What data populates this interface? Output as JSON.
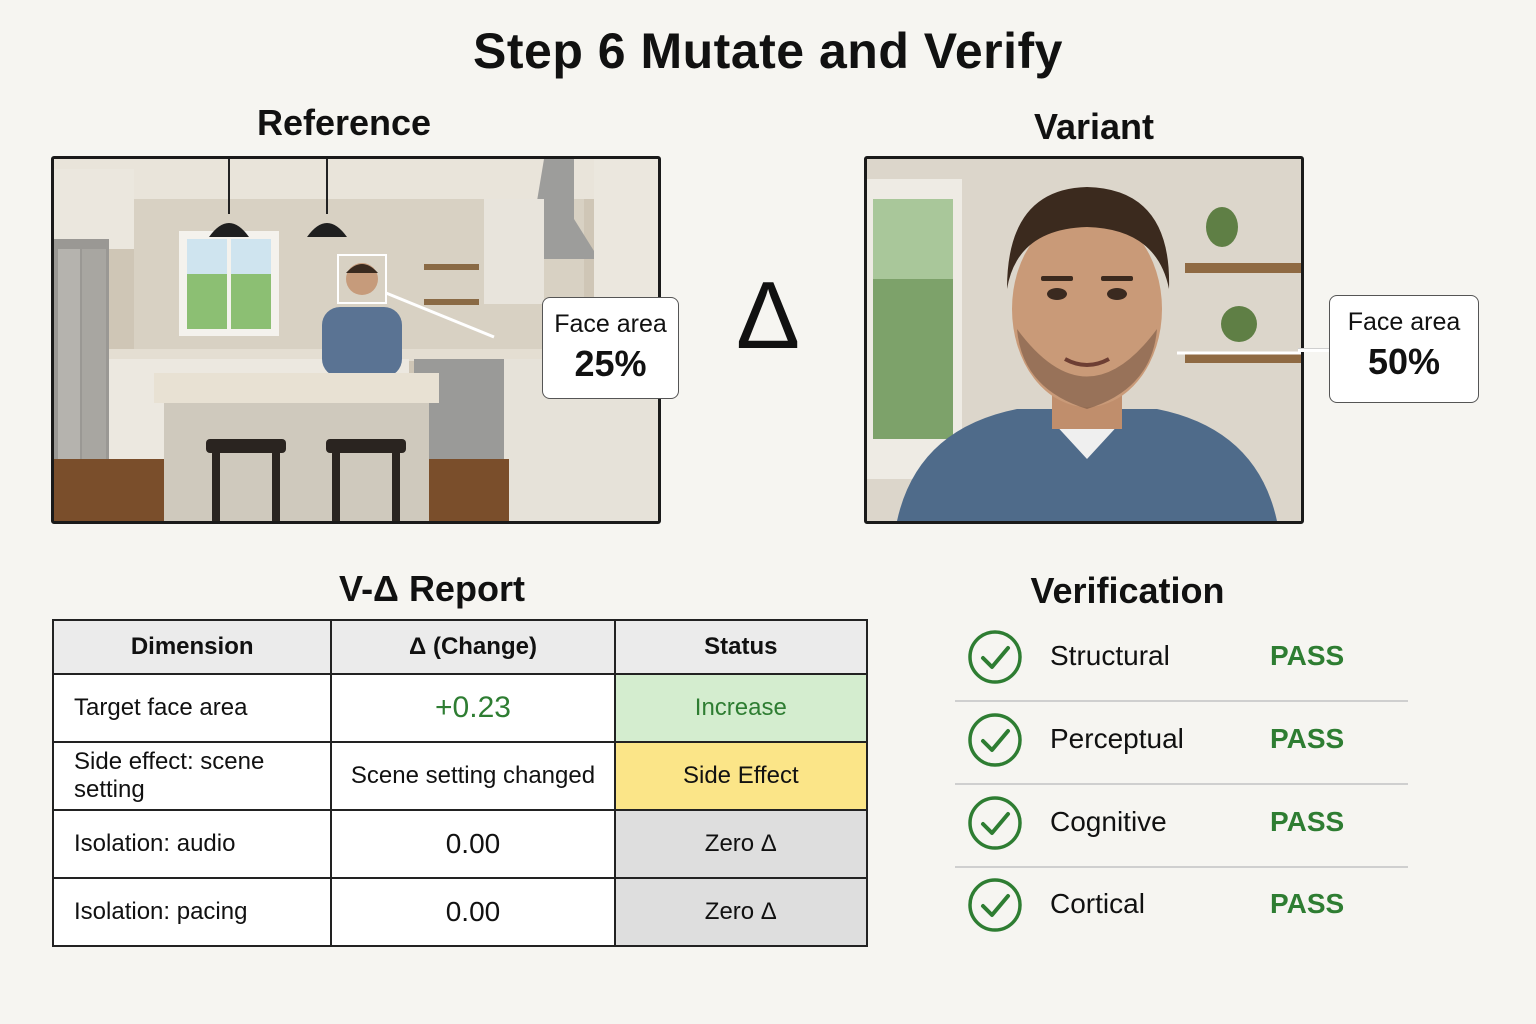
{
  "title": "Step 6 Mutate and Verify",
  "reference": {
    "heading": "Reference",
    "callout_label": "Face area",
    "callout_value": "25%",
    "face_area_fraction": 0.25
  },
  "delta_symbol": "Δ",
  "variant": {
    "heading": "Variant",
    "callout_label": "Face area",
    "callout_value": "50%",
    "face_area_fraction": 0.5
  },
  "report": {
    "heading": "V-Δ Report",
    "columns": [
      "Dimension",
      "Δ (Change)",
      "Status"
    ],
    "rows": [
      {
        "dimension": "Target face area",
        "change": "+0.23",
        "status": "Increase"
      },
      {
        "dimension": "Side effect: scene setting",
        "change": "Scene setting changed",
        "status": "Side Effect"
      },
      {
        "dimension": "Isolation: audio",
        "change": "0.00",
        "status": "Zero Δ"
      },
      {
        "dimension": "Isolation: pacing",
        "change": "0.00",
        "status": "Zero Δ"
      }
    ]
  },
  "verification": {
    "heading": "Verification",
    "items": [
      {
        "label": "Structural",
        "result": "PASS"
      },
      {
        "label": "Perceptual",
        "result": "PASS"
      },
      {
        "label": "Cognitive",
        "result": "PASS"
      },
      {
        "label": "Cortical",
        "result": "PASS"
      }
    ]
  },
  "colors": {
    "pass_green": "#2e7d32",
    "increase_bg": "#d4edcf",
    "side_effect_bg": "#fbe588",
    "zero_bg": "#dedede",
    "change_green": "#2e7d32"
  }
}
